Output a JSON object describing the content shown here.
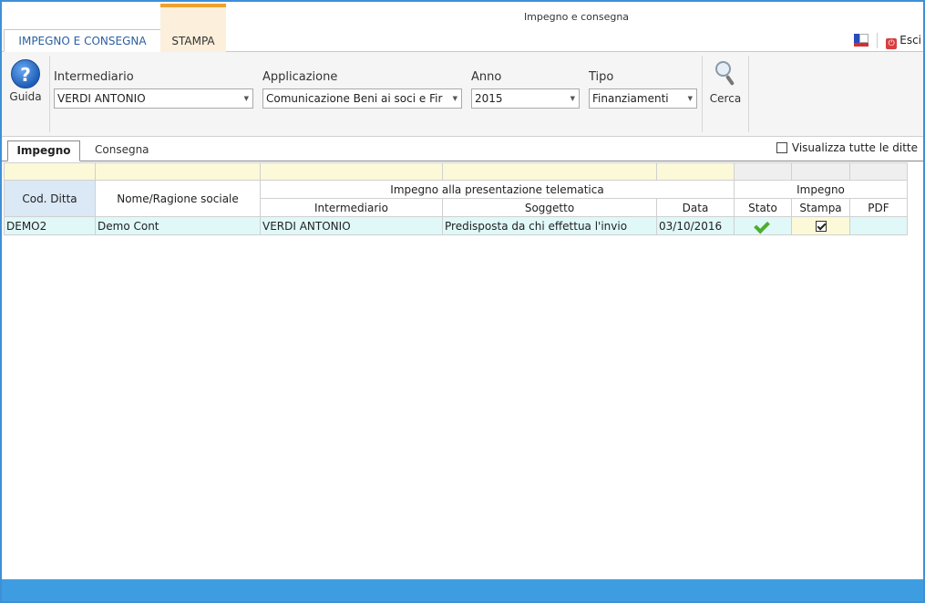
{
  "window": {
    "title": "Impegno e consegna"
  },
  "ribbon_tabs": [
    {
      "label": "IMPEGNO E CONSEGNA"
    },
    {
      "label": "STAMPA"
    }
  ],
  "topbar": {
    "exit_label": "Esci"
  },
  "toolbar": {
    "guida_label": "Guida",
    "cerca_label": "Cerca",
    "intermediario": {
      "label": "Intermediario",
      "value": "VERDI ANTONIO"
    },
    "applicazione": {
      "label": "Applicazione",
      "value": "Comunicazione Beni ai soci e Fir"
    },
    "anno": {
      "label": "Anno",
      "value": "2015"
    },
    "tipo": {
      "label": "Tipo",
      "value": "Finanziamenti"
    }
  },
  "sub_tabs": [
    {
      "label": "Impegno"
    },
    {
      "label": "Consegna"
    }
  ],
  "show_all_label": "Visualizza tutte le ditte",
  "grid": {
    "group_headers": {
      "telematica": "Impegno alla presentazione telematica",
      "impegno": "Impegno"
    },
    "columns": {
      "cod": "Cod. Ditta",
      "nome": "Nome/Ragione sociale",
      "intermediario": "Intermediario",
      "soggetto": "Soggetto",
      "data": "Data",
      "stato": "Stato",
      "stampa": "Stampa",
      "pdf": "PDF"
    },
    "rows": [
      {
        "cod": "DEMO2",
        "nome": "Demo Cont",
        "intermediario": "VERDI ANTONIO",
        "soggetto": "Predisposta da chi effettua l'invio",
        "data": "03/10/2016",
        "stato_icon": "green-check-icon",
        "stampa_checked": true,
        "pdf": ""
      }
    ]
  },
  "colors": {
    "accent": "#3e9de0",
    "filter_row": "#fbf9d8",
    "selected_row": "#e0f8f8",
    "stampa_tab": "#f0a030"
  }
}
